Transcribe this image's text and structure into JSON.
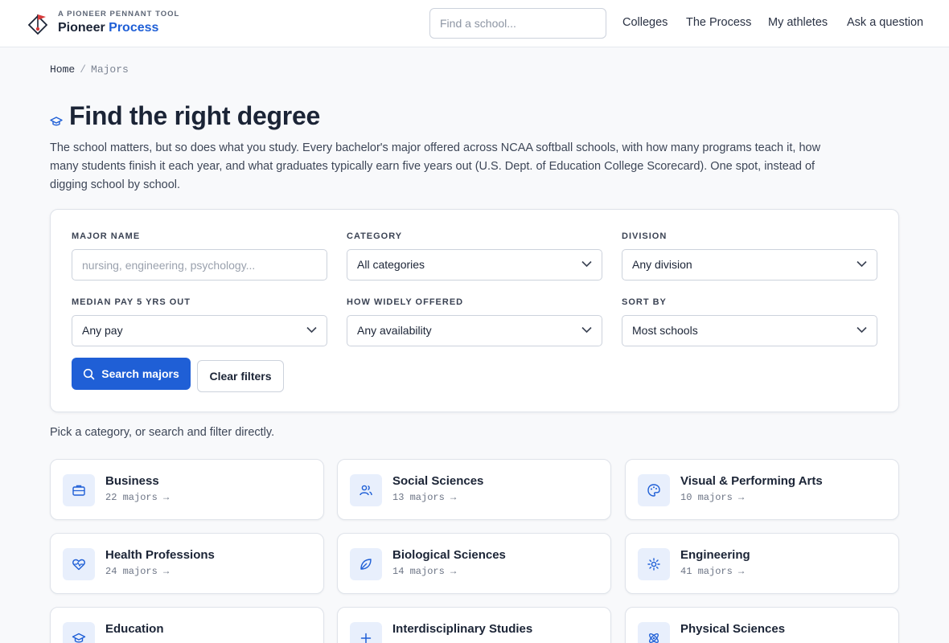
{
  "header": {
    "brand_tag": "A PIONEER PENNANT TOOL",
    "brand_name_part1": "Pioneer",
    "brand_name_part2": "Process",
    "search_placeholder": "Find a school...",
    "nav": [
      "Colleges",
      "The Process",
      "My athletes",
      "Ask a question"
    ]
  },
  "breadcrumb": {
    "home": "Home",
    "separator": "/",
    "current": "Majors"
  },
  "hero": {
    "title": "Find the right degree",
    "intro": "The school matters, but so does what you study. Every bachelor's major offered across NCAA softball schools, with how many programs teach it, how many students finish it each year, and what graduates typically earn five years out (U.S. Dept. of Education College Scorecard). One spot, instead of digging school by school."
  },
  "filters": {
    "major_name": {
      "label": "MAJOR NAME",
      "placeholder": "nursing, engineering, psychology..."
    },
    "category": {
      "label": "CATEGORY",
      "value": "All categories"
    },
    "division": {
      "label": "DIVISION",
      "value": "Any division"
    },
    "median_pay": {
      "label": "MEDIAN PAY 5 YRS OUT",
      "value": "Any pay"
    },
    "availability": {
      "label": "HOW WIDELY OFFERED",
      "value": "Any availability"
    },
    "sort": {
      "label": "SORT BY",
      "value": "Most schools"
    },
    "search_button": "Search majors",
    "clear_button": "Clear filters"
  },
  "hint": "Pick a category, or search and filter directly.",
  "categories": [
    {
      "name": "Business",
      "count": "22 majors →",
      "icon": "briefcase-icon"
    },
    {
      "name": "Social Sciences",
      "count": "13 majors →",
      "icon": "users-icon"
    },
    {
      "name": "Visual & Performing Arts",
      "count": "10 majors →",
      "icon": "palette-icon"
    },
    {
      "name": "Health Professions",
      "count": "24 majors →",
      "icon": "heart-pulse-icon"
    },
    {
      "name": "Biological Sciences",
      "count": "14 majors →",
      "icon": "leaf-icon"
    },
    {
      "name": "Engineering",
      "count": "41 majors →",
      "icon": "cog-icon"
    },
    {
      "name": "Education",
      "count": "",
      "icon": "graduation-cap-icon"
    },
    {
      "name": "Interdisciplinary Studies",
      "count": "",
      "icon": "plus-icon"
    },
    {
      "name": "Physical Sciences",
      "count": "",
      "icon": "atom-icon"
    }
  ],
  "colors": {
    "accent": "#1f5fd6",
    "icon_bg": "#e8effc",
    "text": "#1b2436",
    "logo_red": "#d63a3a"
  }
}
